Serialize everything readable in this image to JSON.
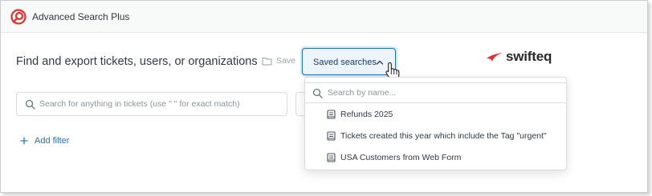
{
  "app": {
    "title": "Advanced Search Plus",
    "logo_icon": "target-logo-icon",
    "logo_color": "#e3302c"
  },
  "main": {
    "title": "Find and export tickets, users, or organizations",
    "save_label": "Save",
    "saved_searches_label": "Saved searches",
    "brand": {
      "name": "swifteq",
      "color": "#e3302c"
    },
    "search": {
      "placeholder": "Search for anything in tickets (use \" \" for exact match)"
    },
    "add_filter_label": "Add filter"
  },
  "dropdown": {
    "search_placeholder": "Search by name...",
    "items": [
      {
        "label": "Refunds 2025",
        "icon": "saved-search-icon"
      },
      {
        "label": "Tickets created this year which include the Tag \"urgent\"",
        "icon": "saved-search-icon"
      },
      {
        "label": "USA Customers from Web Form",
        "icon": "saved-search-icon"
      }
    ]
  },
  "colors": {
    "accent": "#1f73b7",
    "header_bg": "#f8f9f9"
  }
}
